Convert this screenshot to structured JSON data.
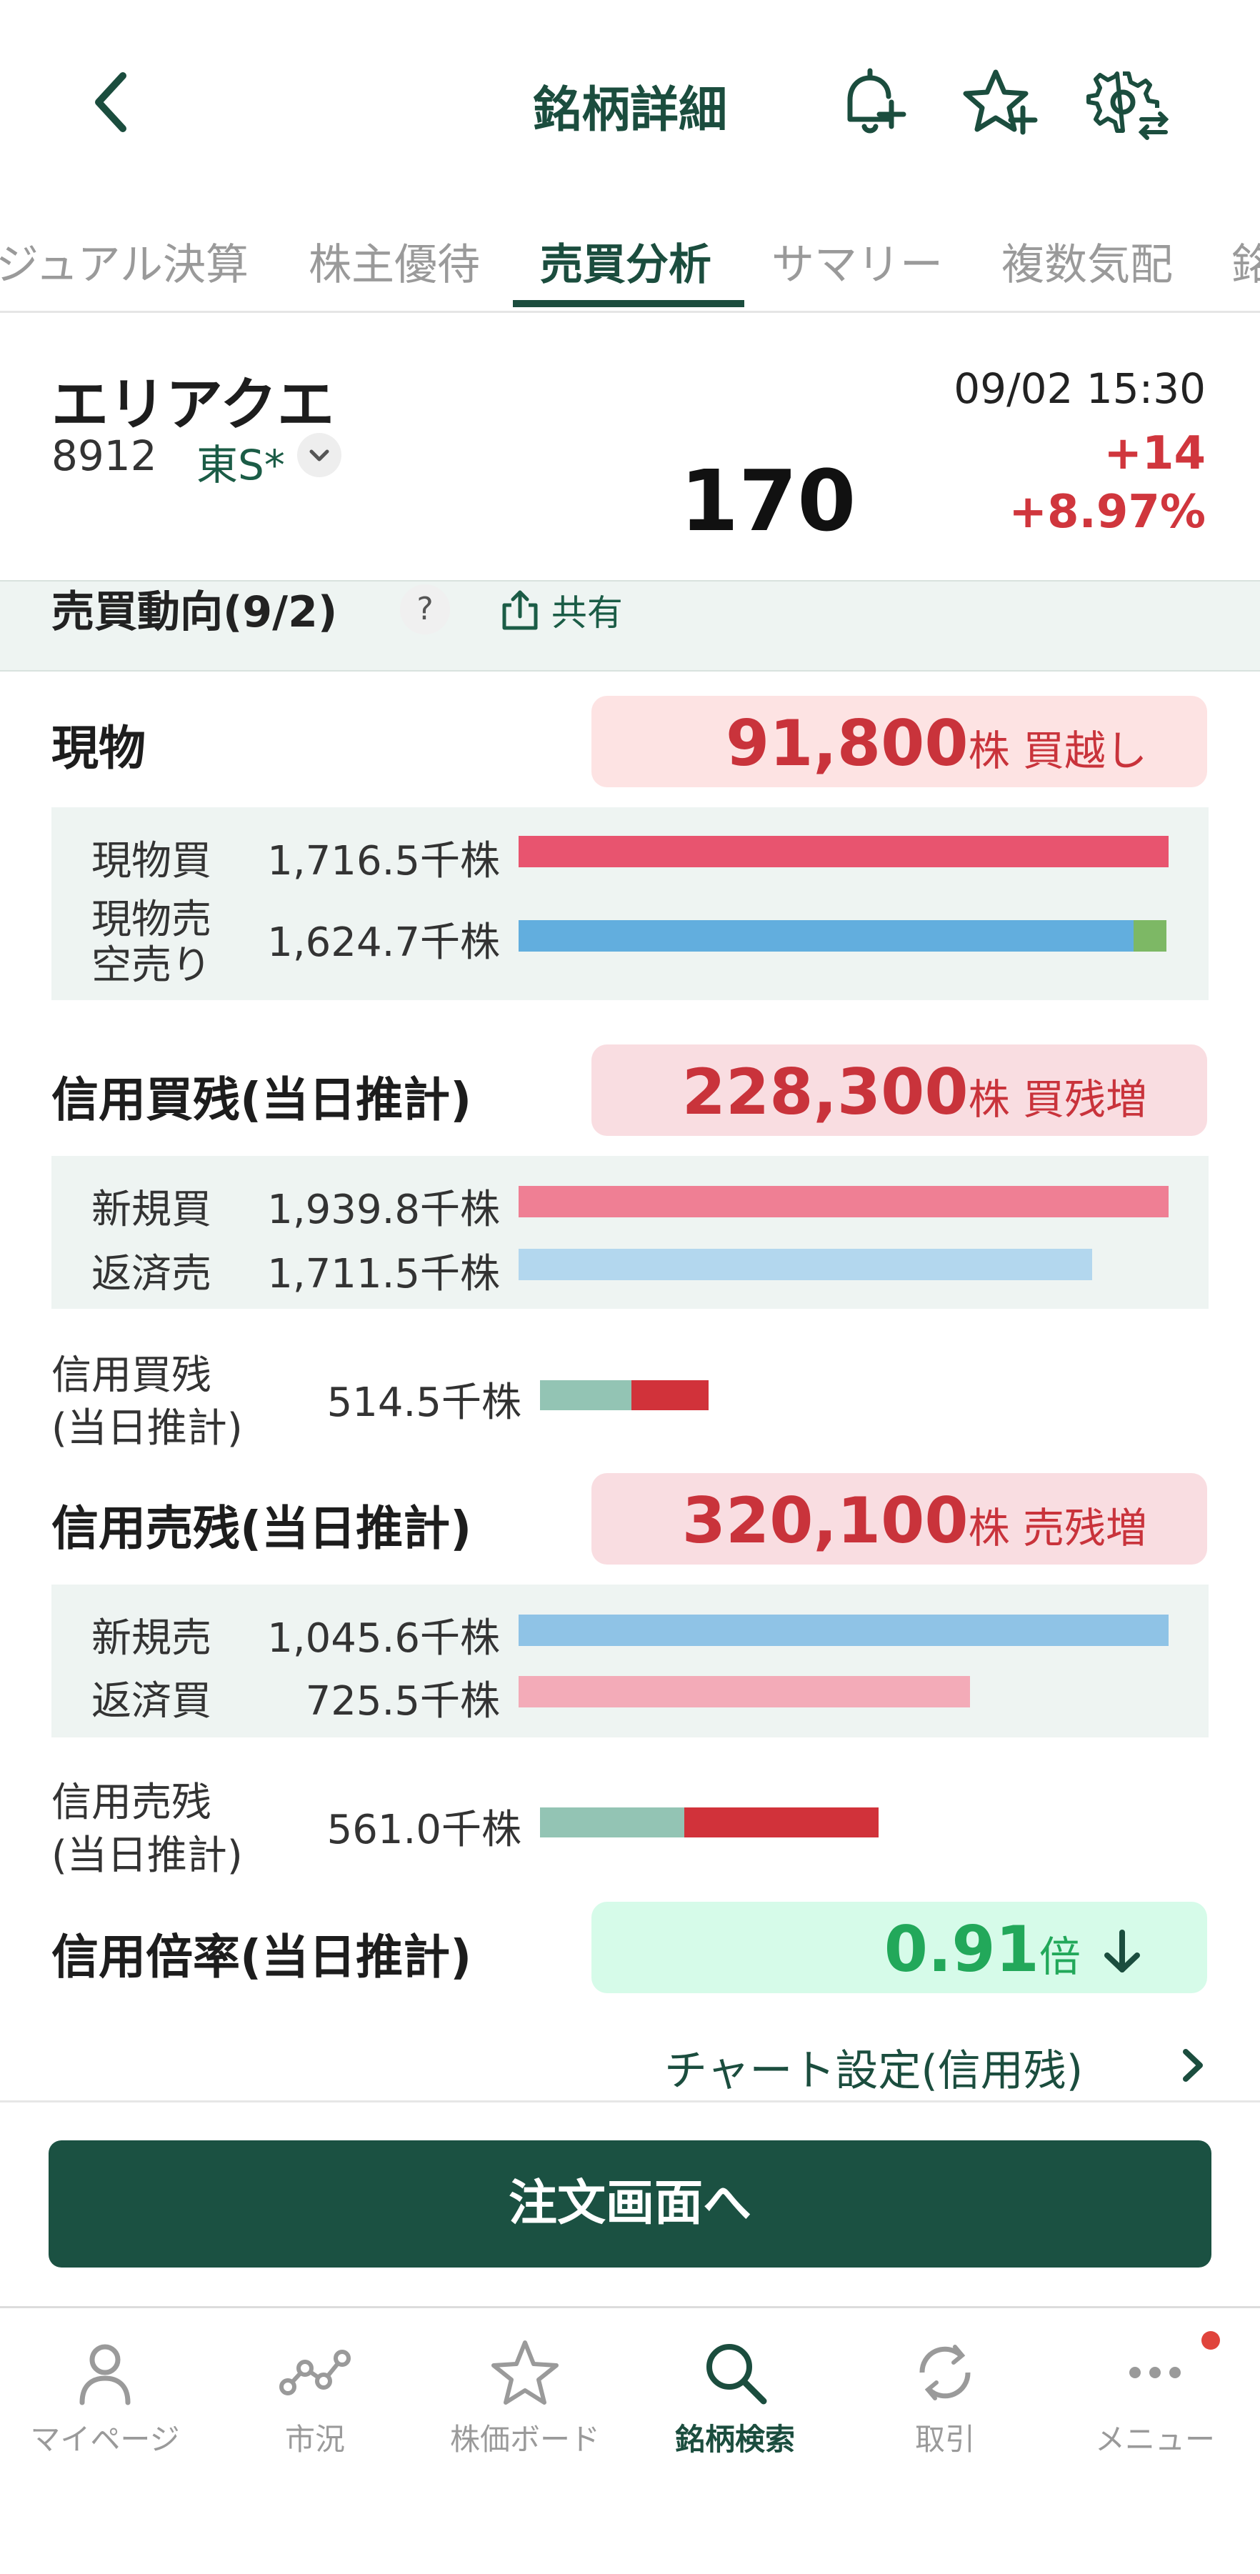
{
  "header": {
    "title": "銘柄詳細"
  },
  "tabs": [
    "ジュアル決算",
    "株主優待",
    "売買分析",
    "サマリー",
    "複数気配",
    "銘"
  ],
  "active_tab": "売買分析",
  "stock": {
    "name": "エリアクエ",
    "code": "8912",
    "market": "東S*",
    "timestamp": "09/02 15:30",
    "price": "170",
    "change": "+14",
    "change_pct": "+8.97%"
  },
  "trend": {
    "title": "売買動向(9/2)",
    "help": "?",
    "share": "共有"
  },
  "genbutsu": {
    "title": "現物",
    "pill_num": "91,800",
    "pill_unit": "株 買越し",
    "rows": [
      {
        "label": "現物買",
        "value": "1,716.5千株",
        "fill": 1.0
      },
      {
        "label": "現物売",
        "label2": "空売り",
        "value": "1,624.7千株",
        "fill": 0.946,
        "extra_fill": 0.05
      }
    ]
  },
  "shinyo_kai": {
    "title": "信用買残(当日推計)",
    "pill_num": "228,300",
    "pill_unit": "株 買残増",
    "rows": [
      {
        "label": "新規買",
        "value": "1,939.8千株",
        "fill": 1.0
      },
      {
        "label": "返済売",
        "value": "1,711.5千株",
        "fill": 0.882
      }
    ],
    "zan_label": "信用買残",
    "zan_label2": "(当日推計)",
    "zan_value": "514.5千株"
  },
  "shinyo_uri": {
    "title": "信用売残(当日推計)",
    "pill_num": "320,100",
    "pill_unit": "株 売残増",
    "rows": [
      {
        "label": "新規売",
        "value": "1,045.6千株",
        "fill": 1.0
      },
      {
        "label": "返済買",
        "value": "725.5千株",
        "fill": 0.694
      }
    ],
    "zan_label": "信用売残",
    "zan_label2": "(当日推計)",
    "zan_value": "561.0千株"
  },
  "bairitsu": {
    "title": "信用倍率(当日推計)",
    "pill_num": "0.91",
    "pill_unit": "倍"
  },
  "chart_setting": "チャート設定(信用残)",
  "order_button": "注文画面へ",
  "nav": [
    {
      "label": "マイページ",
      "icon": "person-icon"
    },
    {
      "label": "市況",
      "icon": "market-icon"
    },
    {
      "label": "株価ボード",
      "icon": "star-icon"
    },
    {
      "label": "銘柄検索",
      "icon": "search-icon"
    },
    {
      "label": "取引",
      "icon": "refresh-icon"
    },
    {
      "label": "メニュー",
      "icon": "dots-icon"
    }
  ],
  "active_nav": "銘柄検索",
  "colors": {
    "brand_green": "#1b4d3e",
    "up_red": "#d0363d",
    "buy_bar": "#e8546f",
    "sell_bar": "#62aede",
    "short_bar": "#7db865",
    "pill_red_bg": "#fde3e3",
    "pill_green_bg": "#d6fbe9",
    "ratio_green": "#22a85a"
  }
}
